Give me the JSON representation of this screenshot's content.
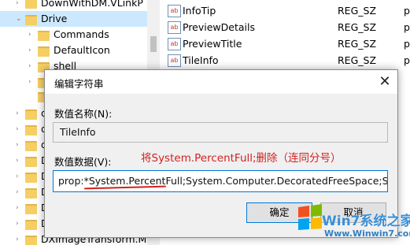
{
  "tree": {
    "items": [
      {
        "label": "DownWithDM.VLinkP"
      },
      {
        "label": "Drive"
      },
      {
        "label": "Commands"
      },
      {
        "label": "DefaultIcon"
      },
      {
        "label": "shell"
      },
      {
        "label": ""
      },
      {
        "label": ""
      },
      {
        "label": "d"
      },
      {
        "label": "d"
      },
      {
        "label": "d"
      },
      {
        "label": "D"
      },
      {
        "label": "D"
      },
      {
        "label": "D"
      },
      {
        "label": "D"
      },
      {
        "label": "D"
      },
      {
        "label": "DXImageTransform.Mi"
      }
    ]
  },
  "values": {
    "rows": [
      {
        "name": "InfoTip",
        "type": "REG_SZ",
        "data": "p"
      },
      {
        "name": "PreviewDetails",
        "type": "REG_SZ",
        "data": "p"
      },
      {
        "name": "PreviewTitle",
        "type": "REG_SZ",
        "data": "p"
      },
      {
        "name": "TileInfo",
        "type": "REG_SZ",
        "data": "p"
      }
    ]
  },
  "dialog": {
    "title": "编辑字符串",
    "close_glyph": "✕",
    "name_label": "数值名称(N):",
    "name_value": "TileInfo",
    "data_label": "数值数据(V):",
    "data_value": "prop:*System.PercentFull;System.Computer.DecoratedFreeSpace;System",
    "ok_label": "确定",
    "cancel_label": "取消"
  },
  "annotation": {
    "text": "将System.PercentFull;删除（连同分号）",
    "color": "#d32020"
  },
  "watermark": {
    "text": "Win7系统之家",
    "url": "Www.Winwin7.com"
  }
}
